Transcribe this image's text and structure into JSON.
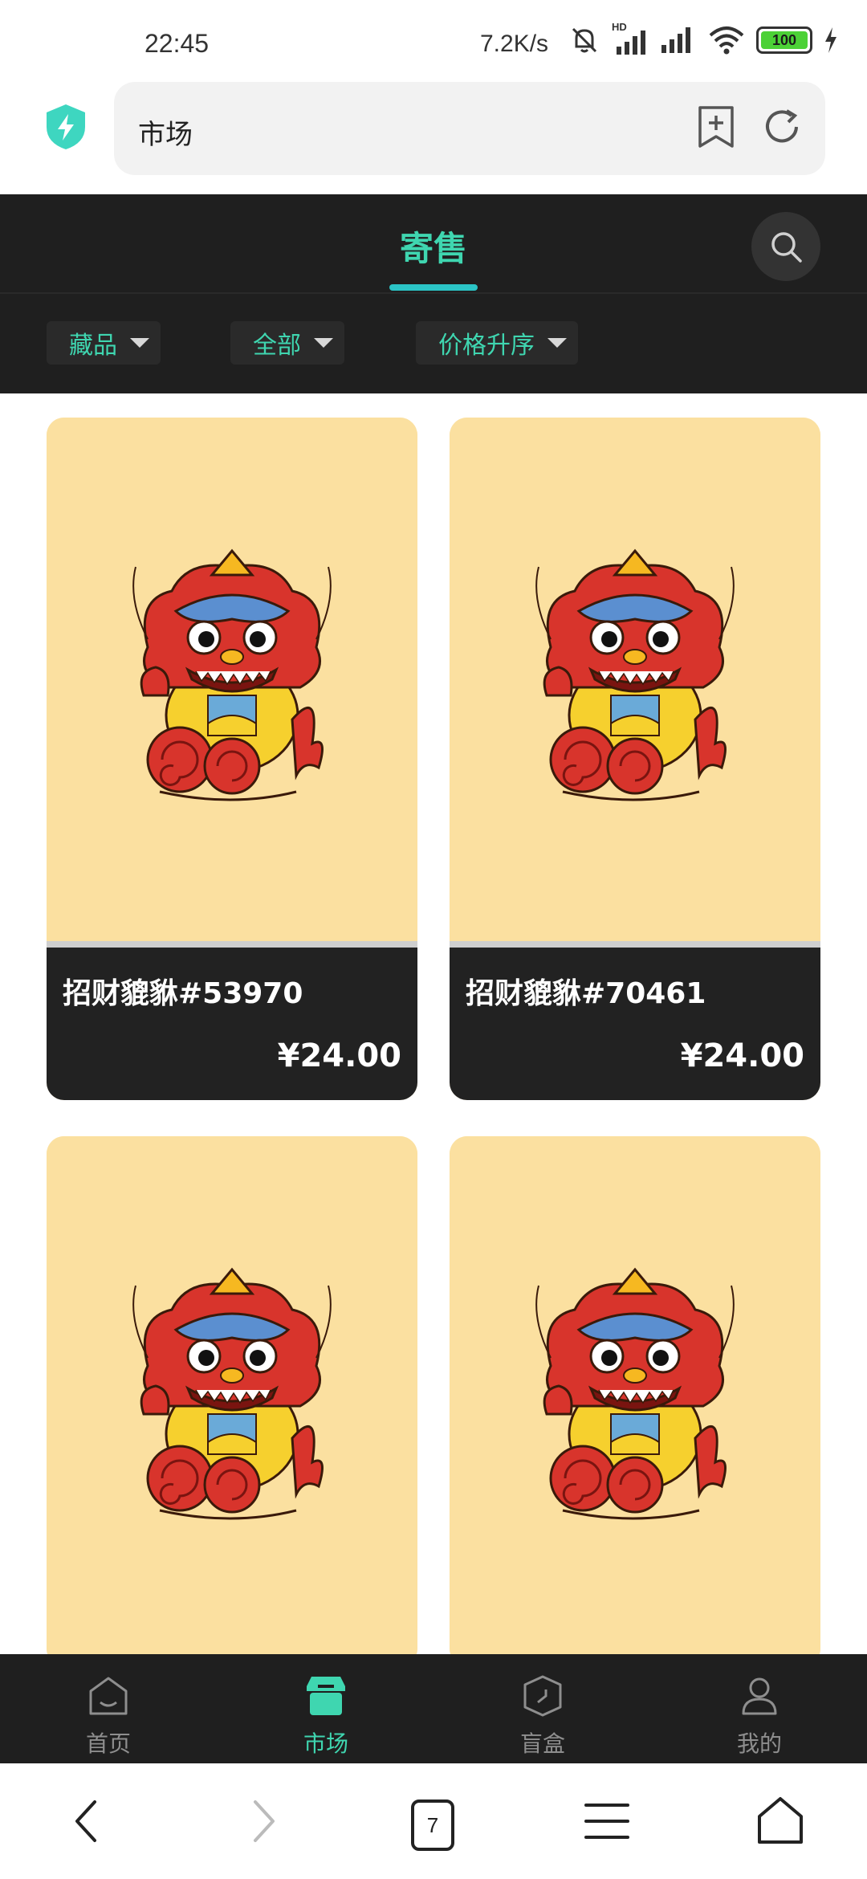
{
  "status_bar": {
    "time": "22:45",
    "net_speed": "7.2K/s",
    "hd_label": "HD",
    "battery": "100"
  },
  "url_bar": {
    "text": "市场"
  },
  "header": {
    "tab_label": "寄售",
    "filters": [
      {
        "label": "藏品"
      },
      {
        "label": "全部"
      },
      {
        "label": "价格升序"
      }
    ]
  },
  "listings": [
    {
      "name": "招财貔貅#53970",
      "price": "¥24.00"
    },
    {
      "name": "招财貔貅#70461",
      "price": "¥24.00"
    },
    {
      "name": "",
      "price": ""
    },
    {
      "name": "",
      "price": ""
    }
  ],
  "bottom_nav": [
    {
      "label": "首页",
      "icon": "home-icon"
    },
    {
      "label": "市场",
      "icon": "market-icon",
      "active": true
    },
    {
      "label": "盲盒",
      "icon": "blind-box-icon"
    },
    {
      "label": "我的",
      "icon": "profile-icon"
    }
  ],
  "system_nav": {
    "tab_count": "7"
  },
  "colors": {
    "accent": "#3fd6b0",
    "header_bg": "#1f1f1f",
    "card_bg": "#fbe0a0"
  }
}
